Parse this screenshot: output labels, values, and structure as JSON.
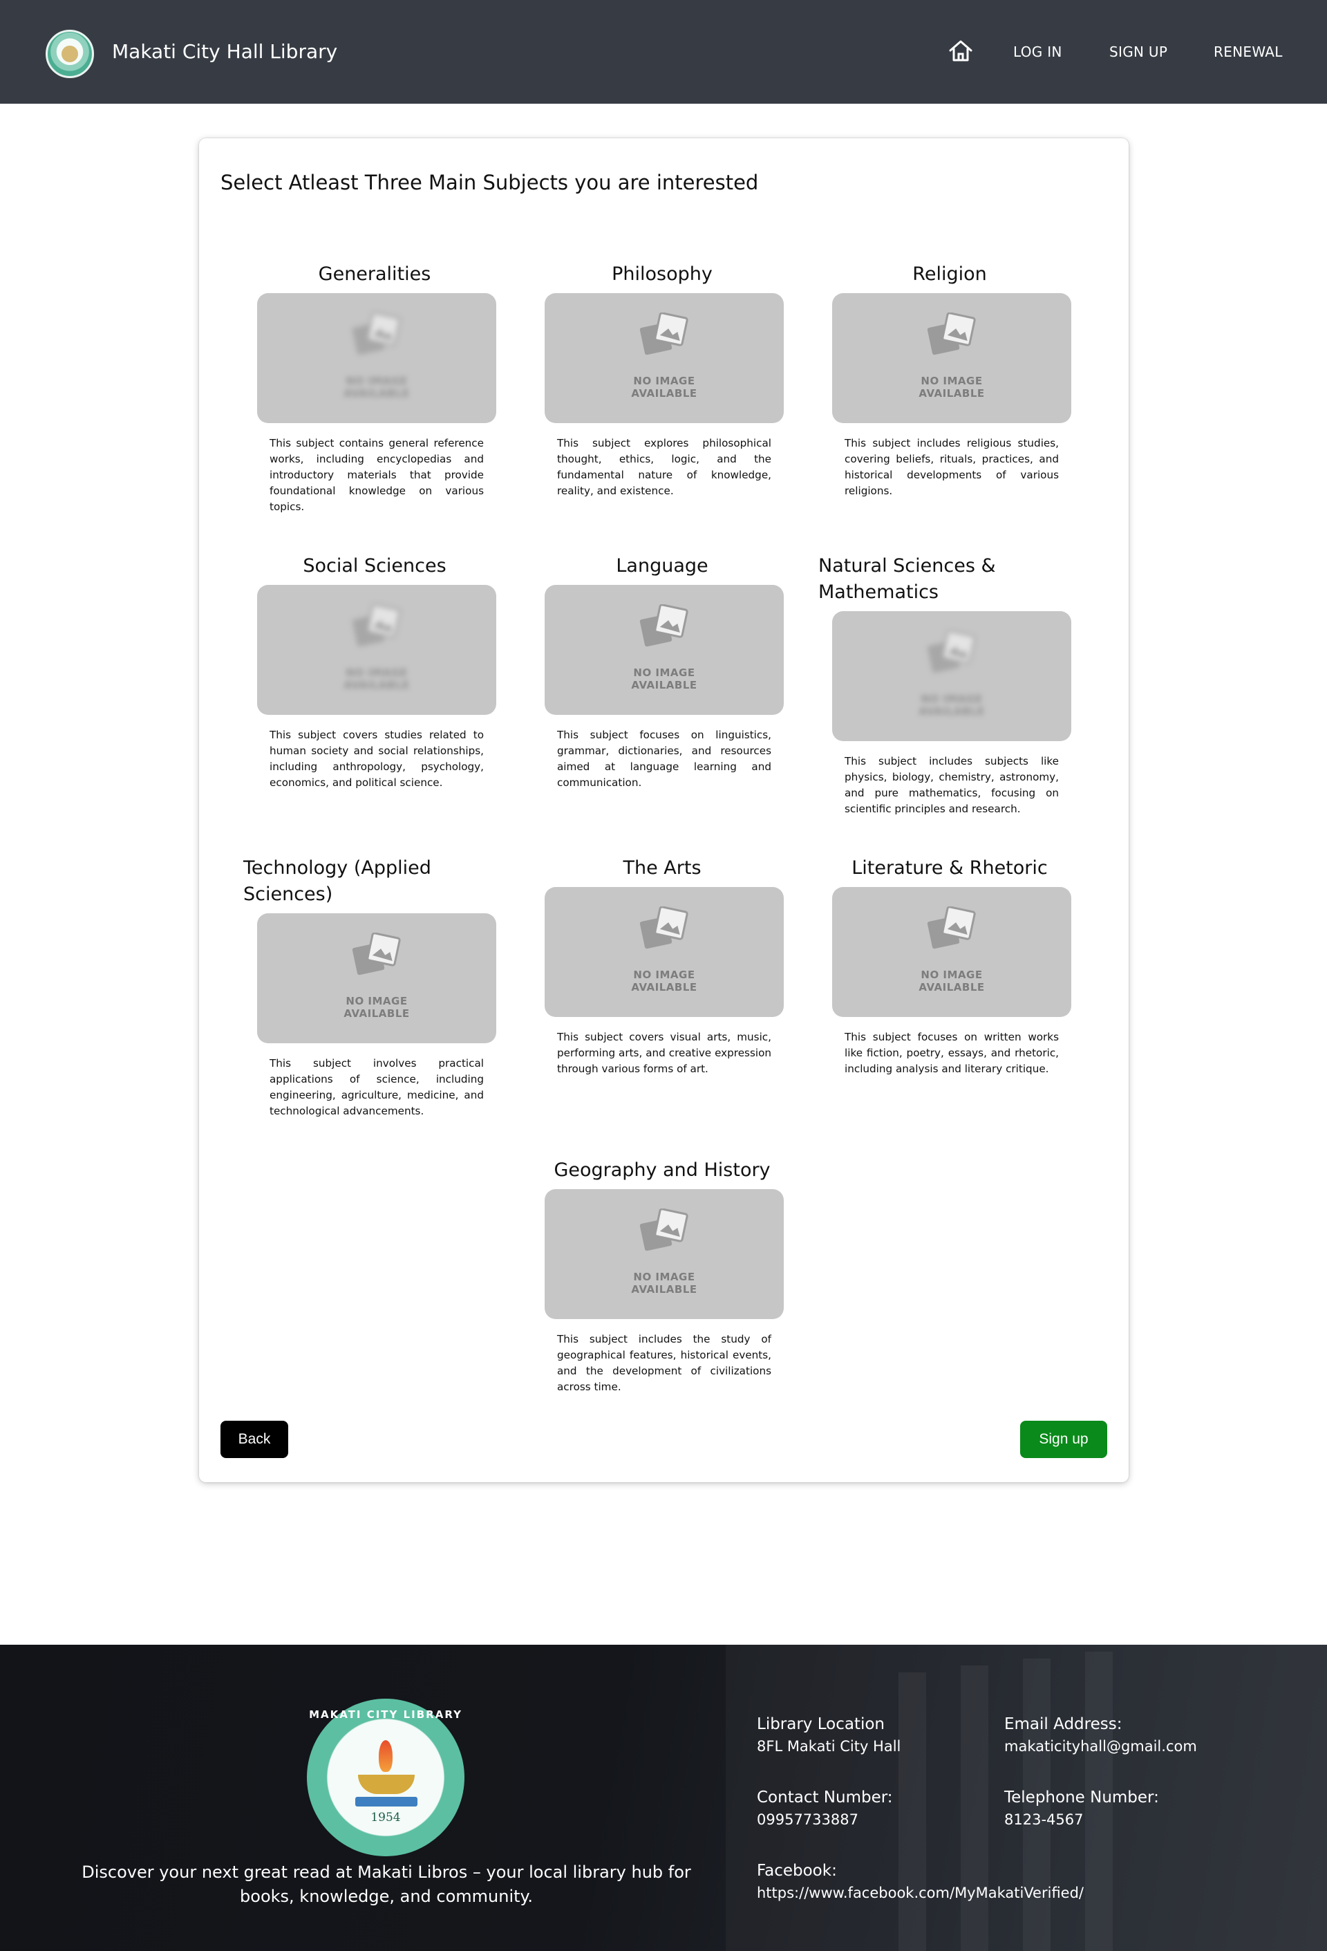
{
  "header": {
    "brand": "Makati City Hall Library",
    "nav": {
      "login": "LOG IN",
      "signup": "SIGN UP",
      "renewal": "RENEWAL"
    }
  },
  "main": {
    "heading": "Select Atleast Three Main Subjects you are interested",
    "no_image_line1": "NO IMAGE",
    "no_image_line2": "AVAILABLE",
    "subjects": [
      {
        "title": "Generalities",
        "description": "This subject contains general reference works, including encyclopedias and introductory materials that provide foundational knowledge on various topics."
      },
      {
        "title": "Philosophy",
        "description": "This subject explores philosophical thought, ethics, logic, and the fundamental nature of knowledge, reality, and existence."
      },
      {
        "title": "Religion",
        "description": "This subject includes religious studies, covering beliefs, rituals, practices, and historical developments of various religions."
      },
      {
        "title": "Social Sciences",
        "description": "This subject covers studies related to human society and social relationships, including anthropology, psychology, economics, and political science."
      },
      {
        "title": "Language",
        "description": "This subject focuses on linguistics, grammar, dictionaries, and resources aimed at language learning and communication."
      },
      {
        "title": "Natural Sciences & Mathematics",
        "description": "This subject includes subjects like physics, biology, chemistry, astronomy, and pure mathematics, focusing on scientific principles and research."
      },
      {
        "title": "Technology (Applied Sciences)",
        "description": "This subject involves practical applications of science, including engineering, agriculture, medicine, and technological advancements."
      },
      {
        "title": "The Arts",
        "description": "This subject covers visual arts, music, performing arts, and creative expression through various forms of art."
      },
      {
        "title": "Literature & Rhetoric",
        "description": "This subject focuses on written works like fiction, poetry, essays, and rhetoric, including analysis and literary critique."
      },
      {
        "title": "Geography and History",
        "description": "This subject includes the study of geographical features, historical events, and the development of civilizations across time."
      }
    ],
    "back_label": "Back",
    "signup_label": "Sign up"
  },
  "footer": {
    "seal_text": "MAKATI CITY LIBRARY",
    "seal_year": "1954",
    "tagline": "Discover your next great read at Makati Libros – your local library hub for books, knowledge, and community.",
    "location_label": "Library Location",
    "location_value": "8FL Makati City Hall",
    "email_label": "Email Address:",
    "email_value": "makaticityhall@gmail.com",
    "contact_label": "Contact Number:",
    "contact_value": "09957733887",
    "telephone_label": "Telephone Number:",
    "telephone_value": "8123-4567",
    "facebook_label": "Facebook:",
    "facebook_value": "https://www.facebook.com/MyMakatiVerified/"
  },
  "colors": {
    "header_bg": "#373c44",
    "placeholder_bg": "#c6c6c6",
    "signup_button": "#0a8a1a",
    "back_button": "#000000",
    "footer_bg": "#14161b"
  },
  "icons": [
    "home-icon",
    "image-placeholder-icon",
    "library-seal-logo"
  ]
}
